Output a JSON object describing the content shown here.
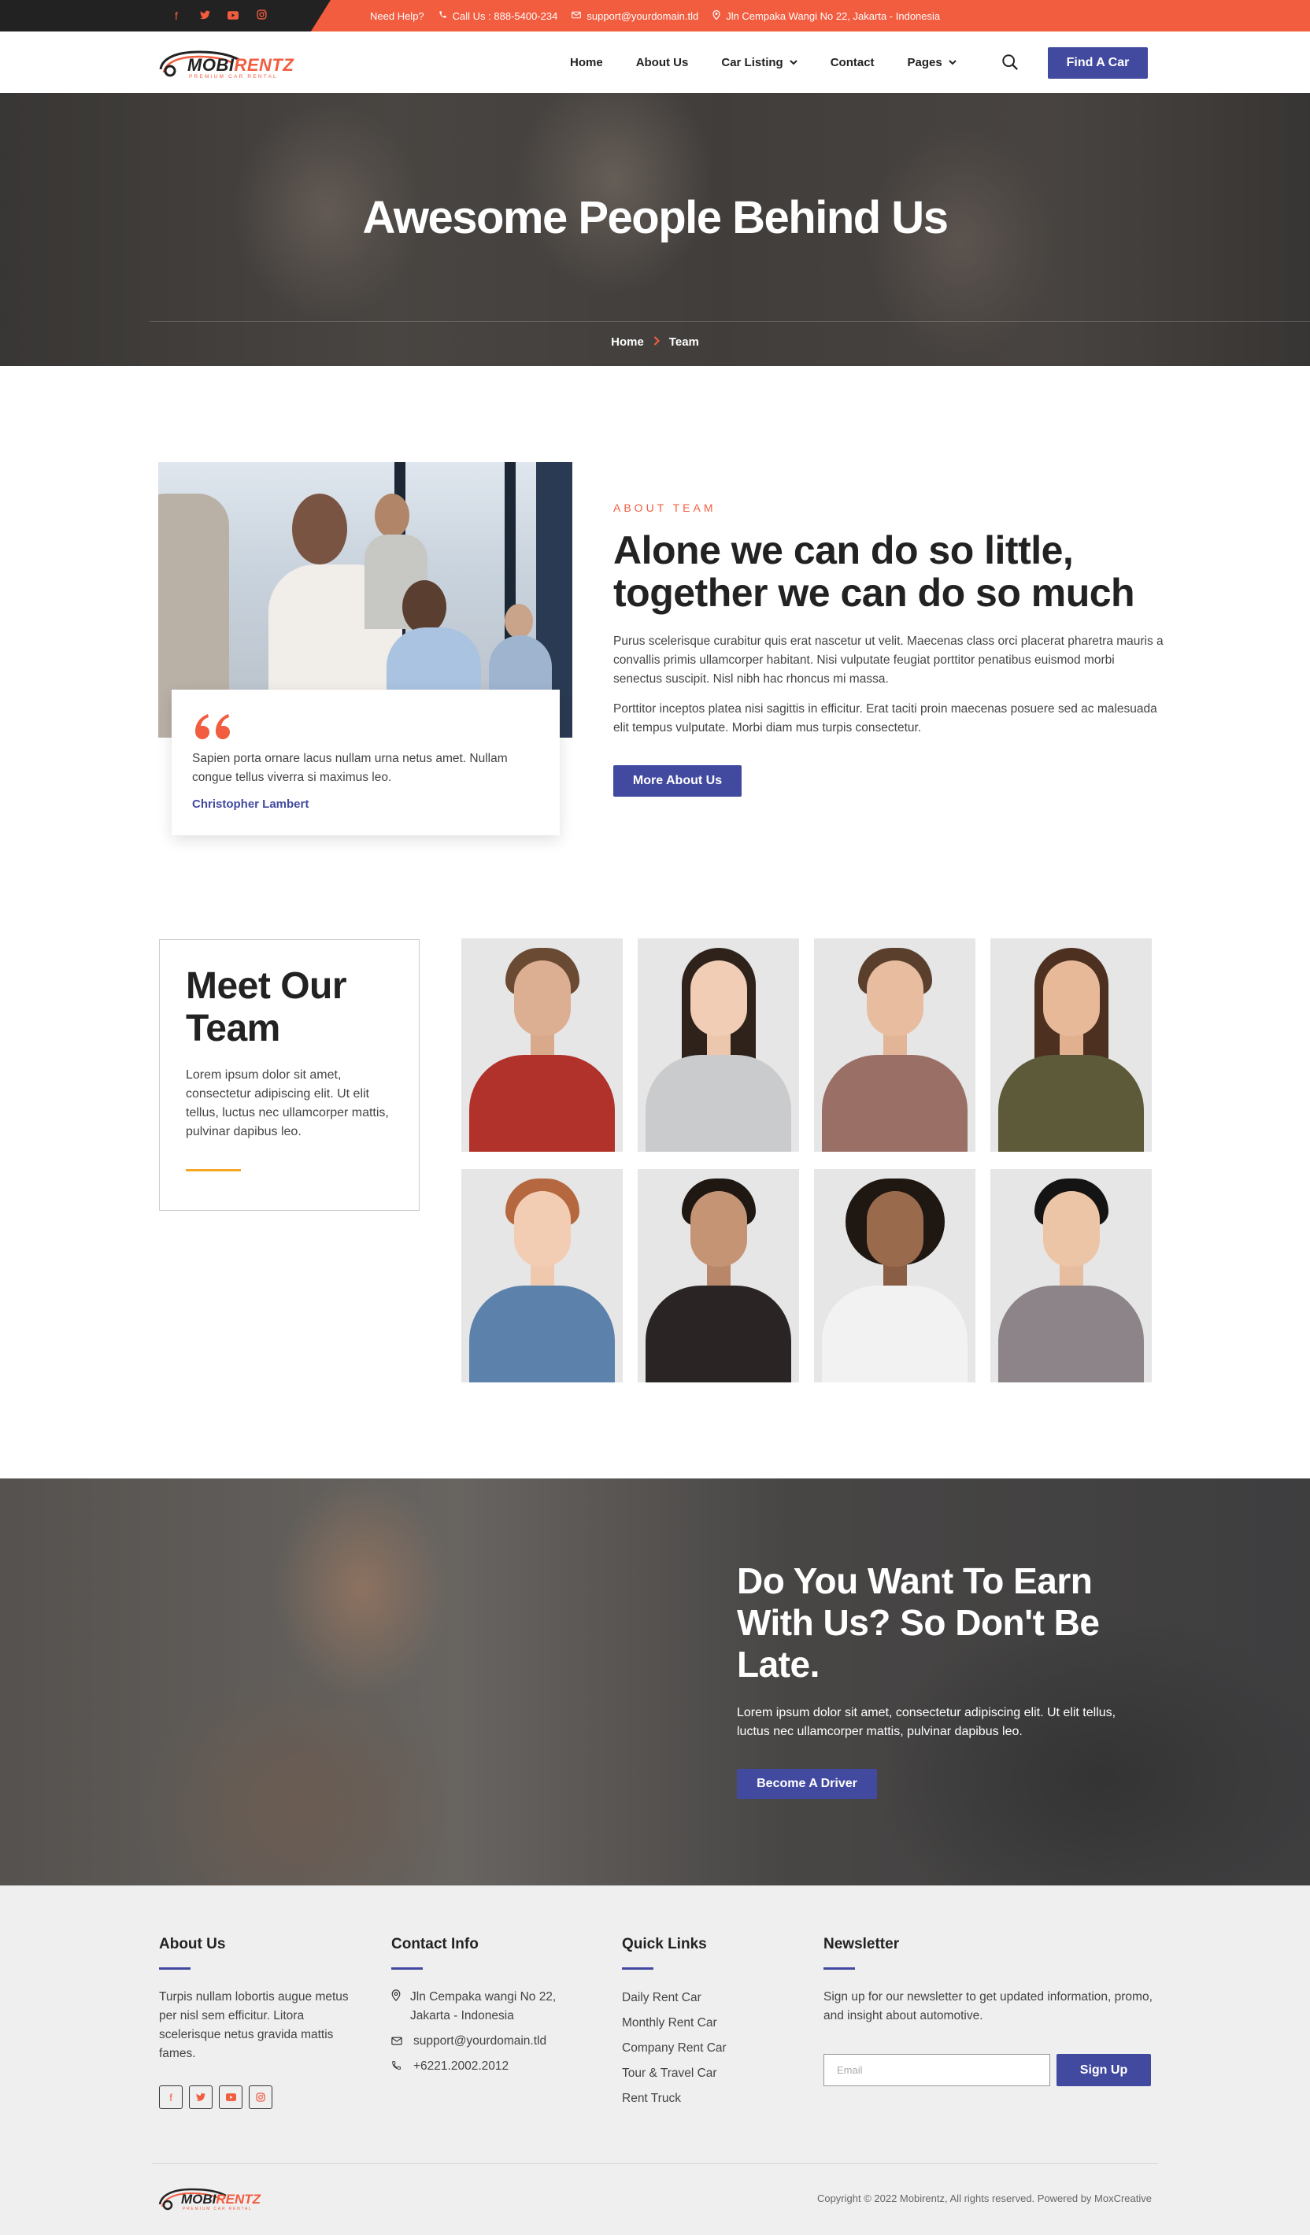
{
  "topbar": {
    "socials": [
      "facebook-icon",
      "twitter-icon",
      "youtube-icon",
      "instagram-icon"
    ],
    "need_help": "Need Help?",
    "phone": "Call Us : 888-5400-234",
    "email": "support@yourdomain.tld",
    "address": "Jln Cempaka Wangi No 22, Jakarta - Indonesia"
  },
  "header": {
    "logo_main": "MOBI",
    "logo_accent": "RENTZ",
    "logo_tagline": "PREMIUM CAR RENTAL",
    "nav": [
      "Home",
      "About Us",
      "Car Listing",
      "Contact",
      "Pages"
    ],
    "cta": "Find A Car"
  },
  "hero": {
    "title": "Awesome People Behind Us",
    "breadcrumb": [
      "Home",
      "Team"
    ]
  },
  "about": {
    "eyebrow": "ABOUT TEAM",
    "title": "Alone we can do so little, together we can do so much",
    "paragraph1": "Purus scelerisque curabitur quis erat nascetur ut velit. Maecenas class orci placerat pharetra mauris a convallis primis ullamcorper habitant. Nisi vulputate feugiat porttitor penatibus euismod morbi senectus suscipit. Nisl nibh hac rhoncus mi massa.",
    "paragraph2": "Porttitor inceptos platea nisi sagittis in efficitur. Erat taciti proin maecenas posuere sed ac malesuada elit tempus vulputate. Morbi diam mus turpis consectetur.",
    "button": "More About Us",
    "quote": "Sapien porta ornare lacus nullam urna netus amet. Nullam congue tellus viverra si maximus leo.",
    "quote_author": "Christopher Lambert"
  },
  "team": {
    "title": "Meet Our Team",
    "description": "Lorem ipsum dolor sit amet, consectetur adipiscing elit. Ut elit tellus, luctus nec ullamcorper mattis, pulvinar dapibus leo."
  },
  "cta": {
    "title": "Do You Want To Earn With Us? So Don't Be Late.",
    "text": "Lorem ipsum dolor sit amet, consectetur adipiscing elit. Ut elit tellus, luctus nec ullamcorper mattis, pulvinar dapibus leo.",
    "button": "Become A Driver"
  },
  "footer": {
    "about_title": "About Us",
    "about_text": "Turpis nullam lobortis augue metus per nisl sem efficitur. Litora scelerisque netus gravida mattis fames.",
    "contact_title": "Contact Info",
    "contact_address": "Jln Cempaka wangi No 22, Jakarta - Indonesia",
    "contact_email": "support@yourdomain.tld",
    "contact_phone": "+6221.2002.2012",
    "links_title": "Quick Links",
    "links": [
      "Daily Rent Car",
      "Monthly Rent Car",
      "Company Rent Car",
      "Tour & Travel Car",
      "Rent Truck"
    ],
    "newsletter_title": "Newsletter",
    "newsletter_text": "Sign up for our newsletter to get updated information, promo, and insight about automotive.",
    "email_placeholder": "Email",
    "signup": "Sign Up",
    "copyright": "Copyright © 2022 Mobirentz, All rights reserved. Powered by MoxCreative"
  },
  "colors": {
    "accent": "#f25c3f",
    "primary": "#424aa0",
    "dark": "#222222"
  }
}
